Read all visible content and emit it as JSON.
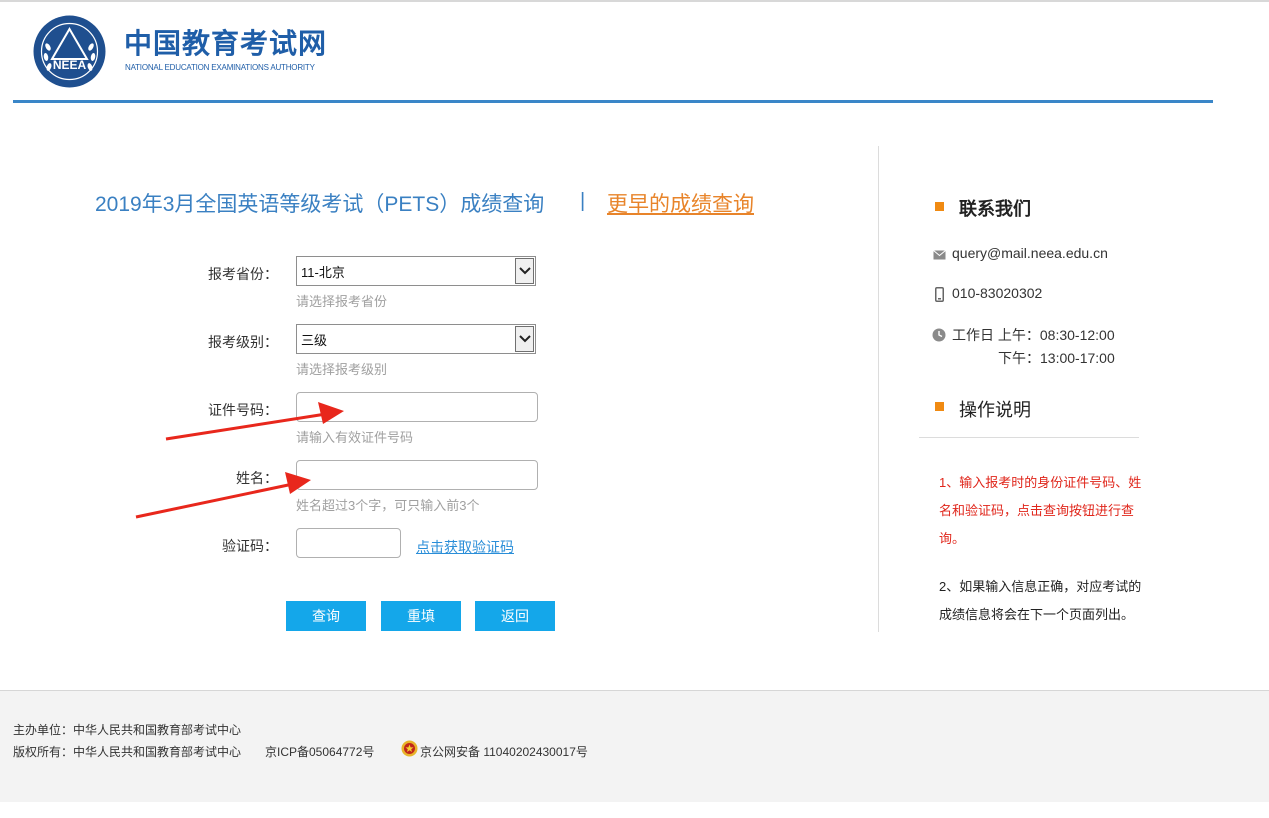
{
  "header": {
    "logo_emblem_text": "NEEA",
    "logo_title": "中国教育考试网",
    "logo_subtitle": "NATIONAL EDUCATION EXAMINATIONS AUTHORITY"
  },
  "main": {
    "title": "2019年3月全国英语等级考试（PETS）成绩查询",
    "separator": "|",
    "earlier_link": "更早的成绩查询",
    "fields": {
      "province": {
        "label": "报考省份：",
        "value": "11-北京",
        "hint": "请选择报考省份"
      },
      "level": {
        "label": "报考级别：",
        "value": "三级",
        "hint": "请选择报考级别"
      },
      "id_number": {
        "label": "证件号码：",
        "value": "",
        "hint": "请输入有效证件号码"
      },
      "name": {
        "label": "姓名：",
        "value": "",
        "hint": "姓名超过3个字，可只输入前3个"
      },
      "captcha": {
        "label": "验证码：",
        "value": "",
        "link": "点击获取验证码"
      }
    },
    "buttons": {
      "query": "查询",
      "reset": "重填",
      "back": "返回"
    }
  },
  "sidebar": {
    "contact_title": "联系我们",
    "email": "query@mail.neea.edu.cn",
    "phone": "010-83020302",
    "hours_am": "工作日 上午：08:30-12:00",
    "hours_pm": "下午：13:00-17:00",
    "instructions_title": "操作说明",
    "instruction_1": "1、输入报考时的身份证件号码、姓名和验证码，点击查询按钮进行查询。",
    "instruction_2": "2、如果输入信息正确，对应考试的成绩信息将会在下一个页面列出。"
  },
  "footer": {
    "organizer": "主办单位：中华人民共和国教育部考试中心",
    "copyright": "版权所有：中华人民共和国教育部考试中心",
    "icp": "京ICP备05064772号",
    "police": "京公网安备 11040202430017号"
  },
  "colors": {
    "brand_blue": "#1f5ea8",
    "title_blue": "#3a80c2",
    "link_orange": "#e8842a",
    "button_blue": "#14a7ea",
    "instruction_red": "#e0261b",
    "annotation_arrow_red": "#e8271c"
  }
}
